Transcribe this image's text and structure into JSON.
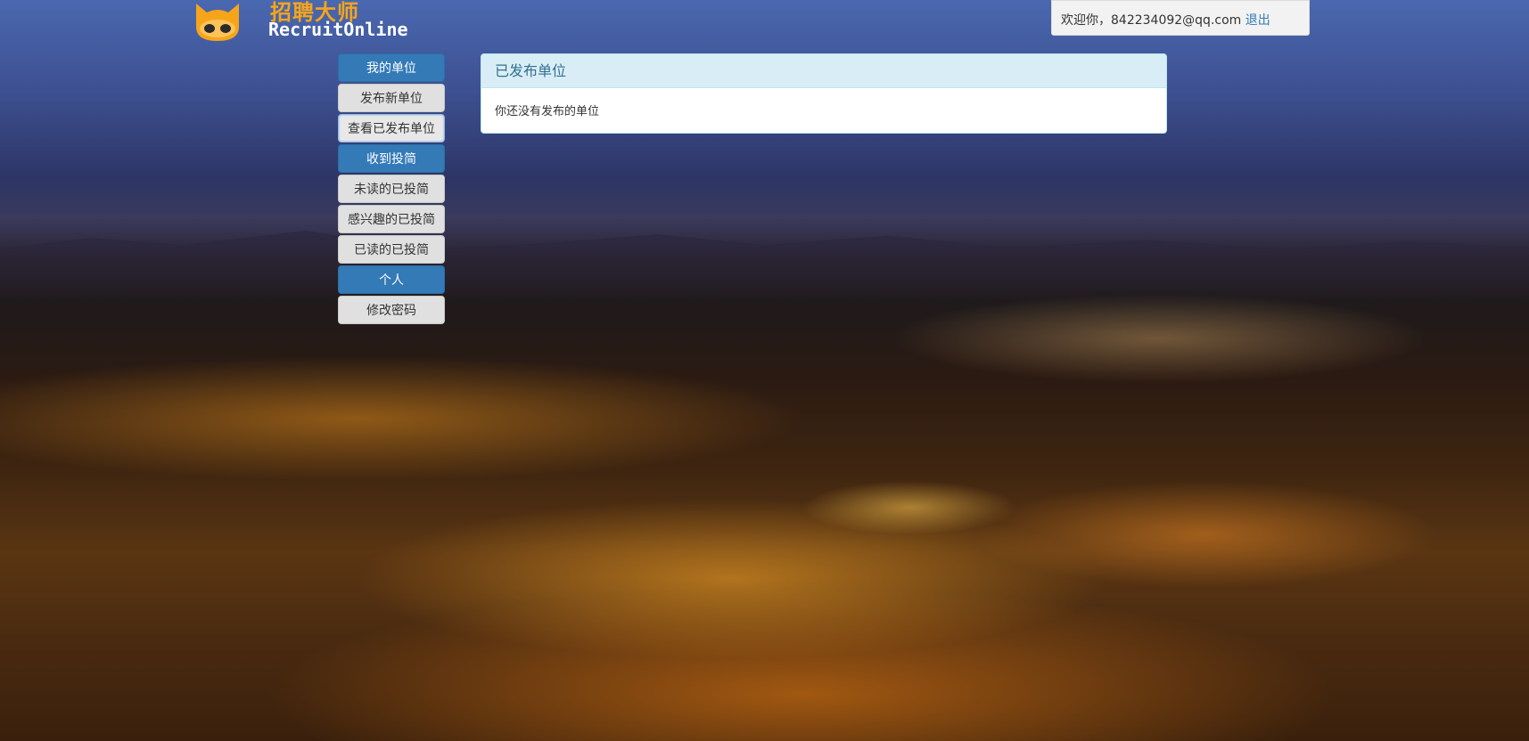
{
  "header": {
    "brand_cn": "招聘大师",
    "brand_en": "RecruitOnline",
    "logo_icon": "cat-logo-icon",
    "welcome_text": "欢迎你，842234092@qq.com",
    "logout_label": "退出"
  },
  "sidebar": {
    "sections": [
      {
        "header": "我的单位",
        "items": [
          "发布新单位",
          "查看已发布单位"
        ]
      },
      {
        "header": "收到投简",
        "items": [
          "未读的已投简",
          "感兴趣的已投简",
          "已读的已投简"
        ]
      },
      {
        "header": "个人",
        "items": [
          "修改密码"
        ]
      }
    ],
    "active_item": "查看已发布单位"
  },
  "main": {
    "panel_title": "已发布单位",
    "panel_message": "你还没有发布的单位"
  },
  "colors": {
    "primary": "#337ab7",
    "brand_orange": "#f6a51a",
    "panel_heading_bg": "#d9edf7",
    "panel_heading_text": "#31708f"
  }
}
